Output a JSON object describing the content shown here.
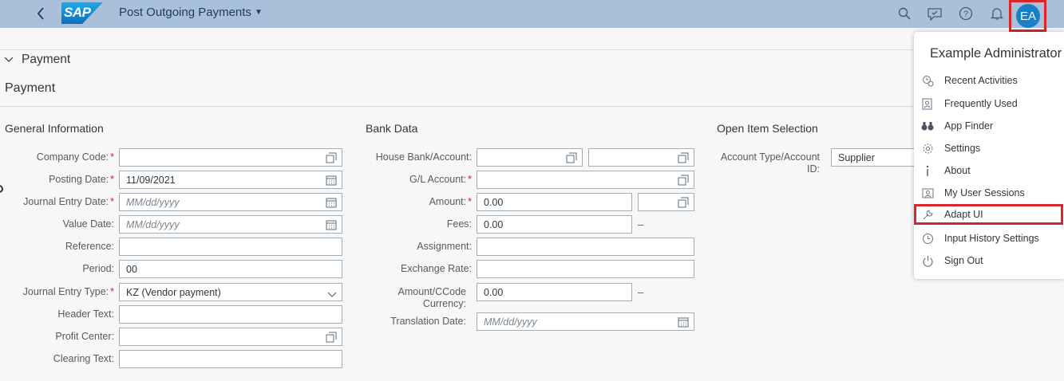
{
  "shell": {
    "logo_text": "SAP",
    "app_title": "Post Outgoing Payments",
    "avatar_initials": "EA",
    "icons": [
      "back-icon",
      "search-icon",
      "notes-icon",
      "help-icon",
      "bell-icon"
    ]
  },
  "section": {
    "toggle_label": "Payment",
    "title": "Payment"
  },
  "general": {
    "title": "General Information",
    "company_code": {
      "label": "Company Code:",
      "required": "*",
      "value": ""
    },
    "posting_date": {
      "label": "Posting Date:",
      "required": "*",
      "value": "11/09/2021"
    },
    "journal_entry_date": {
      "label": "Journal Entry Date:",
      "required": "*",
      "placeholder": "MM/dd/yyyy"
    },
    "value_date": {
      "label": "Value Date:",
      "placeholder": "MM/dd/yyyy"
    },
    "reference": {
      "label": "Reference:",
      "value": ""
    },
    "period": {
      "label": "Period:",
      "value": "00"
    },
    "journal_entry_type": {
      "label": "Journal Entry Type:",
      "required": "*",
      "value": "KZ (Vendor payment)"
    },
    "header_text": {
      "label": "Header Text:",
      "value": ""
    },
    "profit_center": {
      "label": "Profit Center:",
      "value": ""
    },
    "clearing_text": {
      "label": "Clearing Text:",
      "value": ""
    }
  },
  "bank": {
    "title": "Bank Data",
    "house_bank": {
      "label": "House Bank/Account:",
      "value": "",
      "value2": ""
    },
    "gl_account": {
      "label": "G/L Account:",
      "required": "*",
      "value": ""
    },
    "amount": {
      "label": "Amount:",
      "required": "*",
      "value": "0.00",
      "currency": ""
    },
    "fees": {
      "label": "Fees:",
      "value": "0.00",
      "suffix": "–"
    },
    "assignment": {
      "label": "Assignment:",
      "value": ""
    },
    "exchange_rate": {
      "label": "Exchange Rate:",
      "value": ""
    },
    "amount_ccode": {
      "label_line1": "Amount/CCode",
      "label_line2": "Currency:",
      "value": "0.00",
      "suffix": "–"
    },
    "translation_date": {
      "label": "Translation Date:",
      "placeholder": "MM/dd/yyyy"
    }
  },
  "open_item": {
    "title": "Open Item Selection",
    "account_type": {
      "label_line1": "Account Type/Account",
      "label_line2": "ID:",
      "value": "Supplier"
    }
  },
  "user_menu": {
    "title": "Example Administrator",
    "items": [
      {
        "label": "Recent Activities",
        "icon": "recent-activities-icon"
      },
      {
        "label": "Frequently Used",
        "icon": "frequently-used-icon"
      },
      {
        "label": "App Finder",
        "icon": "binoculars-icon"
      },
      {
        "label": "Settings",
        "icon": "gear-icon"
      },
      {
        "label": "About",
        "icon": "info-icon"
      },
      {
        "label": "My User Sessions",
        "icon": "user-sessions-icon"
      },
      {
        "label": "Adapt UI",
        "icon": "wrench-icon"
      },
      {
        "label": "Input History Settings",
        "icon": "clock-icon"
      },
      {
        "label": "Sign Out",
        "icon": "power-icon"
      }
    ]
  },
  "colors": {
    "shell_bar": "#a8c0d9",
    "avatar": "#1a80c6",
    "highlight_border": "#d9262b",
    "required": "#c82329"
  }
}
